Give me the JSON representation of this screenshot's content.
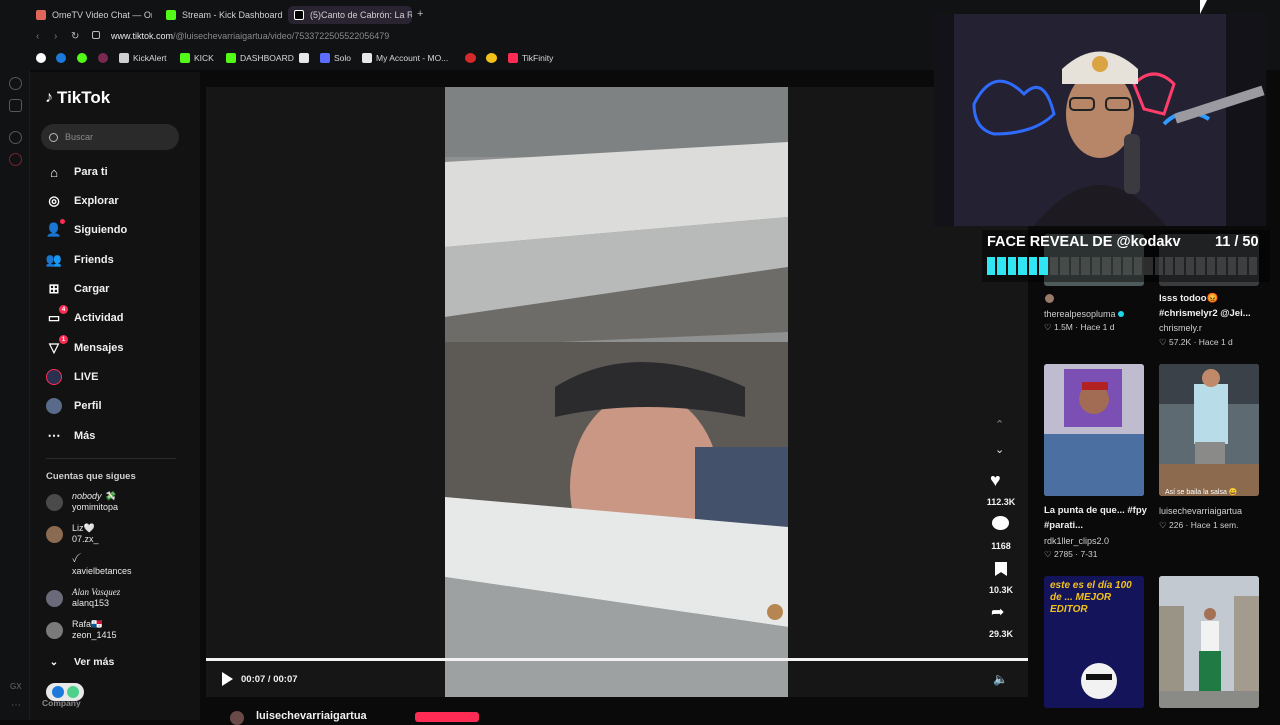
{
  "browser": {
    "tabs": [
      {
        "label": "OmeTV Video Chat — Om",
        "color": "#e0665b"
      },
      {
        "label": "Stream - Kick Dashboard",
        "color": "#53fc18"
      },
      {
        "label": "(5)Canto de Cabrón: La R",
        "color": "#ffffff"
      }
    ],
    "url_host": "www.tiktok.com",
    "url_path": "/@luisechevarriaigartua/video/7533722505522056479",
    "bookmarks": [
      {
        "label": "KickAlert",
        "color": "#cfcfcf"
      },
      {
        "label": "KICK",
        "color": "#53fc18"
      },
      {
        "label": "DASHBOARD",
        "color": "#53fc18"
      },
      {
        "label": "Solo",
        "color": "#5b6cff"
      },
      {
        "label": "My Account - MO...",
        "color": "#e8e8e8"
      },
      {
        "label": "TikFinity",
        "color": "#fe2c55"
      }
    ]
  },
  "sidebar": {
    "logo": "TikTok",
    "search_placeholder": "Buscar",
    "nav": [
      {
        "label": "Para ti",
        "icon": "home-icon"
      },
      {
        "label": "Explorar",
        "icon": "compass-icon"
      },
      {
        "label": "Siguiendo",
        "icon": "user-follow-icon"
      },
      {
        "label": "Friends",
        "icon": "friends-icon"
      },
      {
        "label": "Cargar",
        "icon": "upload-icon"
      },
      {
        "label": "Actividad",
        "icon": "activity-icon",
        "badge": "4"
      },
      {
        "label": "Mensajes",
        "icon": "messages-icon",
        "badge": "1"
      },
      {
        "label": "LIVE",
        "icon": "live-icon"
      },
      {
        "label": "Perfil",
        "icon": "profile-icon"
      },
      {
        "label": "Más",
        "icon": "more-icon"
      }
    ],
    "following_title": "Cuentas que sigues",
    "following": [
      {
        "display": "nobody 💸",
        "handle": "yomimitopa"
      },
      {
        "display": "Liz🤍",
        "handle": "07.zx_"
      },
      {
        "display": "ꪜ",
        "handle": "xavielbetances"
      },
      {
        "display": "Alan Vasquez",
        "handle": "alanq153"
      },
      {
        "display": "Rafa🇵🇦",
        "handle": "zeon_1415"
      }
    ],
    "see_more": "Ver más",
    "footer_label": "Company"
  },
  "player": {
    "time": "00:07 / 00:07",
    "progress": 1.0,
    "author": "luisechevarriaigartua"
  },
  "actions": {
    "likes": "112.3K",
    "comments": "1168",
    "saves": "10.3K",
    "shares": "29.3K"
  },
  "overlay": {
    "title": "FACE REVEAL DE @kodakv",
    "count": "11 / 50",
    "progress": 0.22
  },
  "grid": [
    {
      "title": "",
      "user": "therealpesopluma",
      "likes": "1.5M",
      "age": "Hace 1 d",
      "verified": true
    },
    {
      "title": "Isss todoo😡 #chrismelyr2 @Jei...",
      "user": "chrismely.r",
      "likes": "57.2K",
      "age": "Hace 1 d"
    },
    {
      "title": "La punta de que... #fpy #parati...",
      "user": "rdk1ller_clips2.0",
      "likes": "2785",
      "age": "7-31"
    },
    {
      "title": "",
      "user": "luisechevarriaigartua",
      "likes": "226",
      "age": "Hace 1 sem.",
      "caption": "Así se baila la salsa 😄"
    },
    {
      "title": "",
      "user": "",
      "likes": "",
      "age": "",
      "caption": "este es el día 100 de ... MEJOR EDITOR"
    },
    {
      "title": "",
      "user": "",
      "likes": "",
      "age": ""
    }
  ]
}
